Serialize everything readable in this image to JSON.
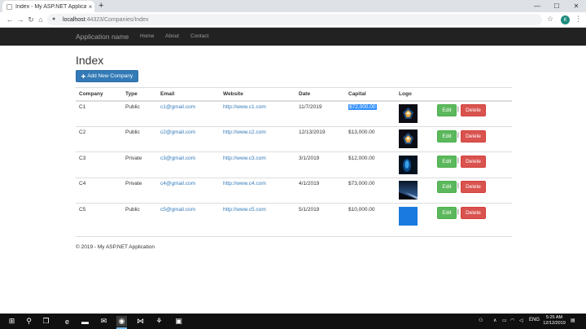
{
  "browser": {
    "tab_title": "Index - My ASP.NET Application",
    "tab_close": "×",
    "new_tab": "+",
    "url_host": "localhost",
    "url_path": ":44323/Companies/Index",
    "profile_initial": "K",
    "window_controls": {
      "minimize": "—",
      "maximize": "☐",
      "close": "✕"
    }
  },
  "app": {
    "brand": "Application name",
    "nav": [
      "Home",
      "About",
      "Contact"
    ]
  },
  "page": {
    "title": "Index",
    "add_button": "Add New Company",
    "columns": [
      "Company",
      "Type",
      "Email",
      "Website",
      "Date",
      "Capital",
      "Logo"
    ],
    "rows": [
      {
        "company": "C1",
        "type": "Public",
        "email": "c1@gmail.com",
        "website": "http://www.c1.com",
        "date": "11/7/2019",
        "capital": "$72,000.00",
        "logo": "dark-app-icon"
      },
      {
        "company": "C2",
        "type": "Public",
        "email": "c2@gmail.com",
        "website": "http://www.c2.com",
        "date": "12/13/2019",
        "capital": "$13,000.00",
        "logo": "dark-app-icon"
      },
      {
        "company": "C3",
        "type": "Private",
        "email": "c3@gmail.com",
        "website": "http://www.c3.com",
        "date": "3/1/2019",
        "capital": "$12,000.00",
        "logo": "blue-glow-image"
      },
      {
        "company": "C4",
        "type": "Private",
        "email": "c4@gmail.com",
        "website": "http://www.c4.com",
        "date": "4/1/2019",
        "capital": "$73,000.00",
        "logo": "night-sky-image"
      },
      {
        "company": "C5",
        "type": "Public",
        "email": "c5@gmail.com",
        "website": "http://www.c5.com",
        "date": "5/1/2019",
        "capital": "$10,000.00",
        "logo": "solid-blue-image"
      }
    ],
    "edit_label": "Edit",
    "delete_label": "Delete",
    "separator": "|",
    "footer": "© 2019 - My ASP.NET Application"
  },
  "taskbar": {
    "language": "ENG",
    "time": "5:25 AM",
    "date": "12/12/2019"
  },
  "colors": {
    "navbar": "#222222",
    "primary": "#337ab7",
    "success": "#5cb85c",
    "danger": "#d9534f",
    "selection": "#3390ff"
  }
}
